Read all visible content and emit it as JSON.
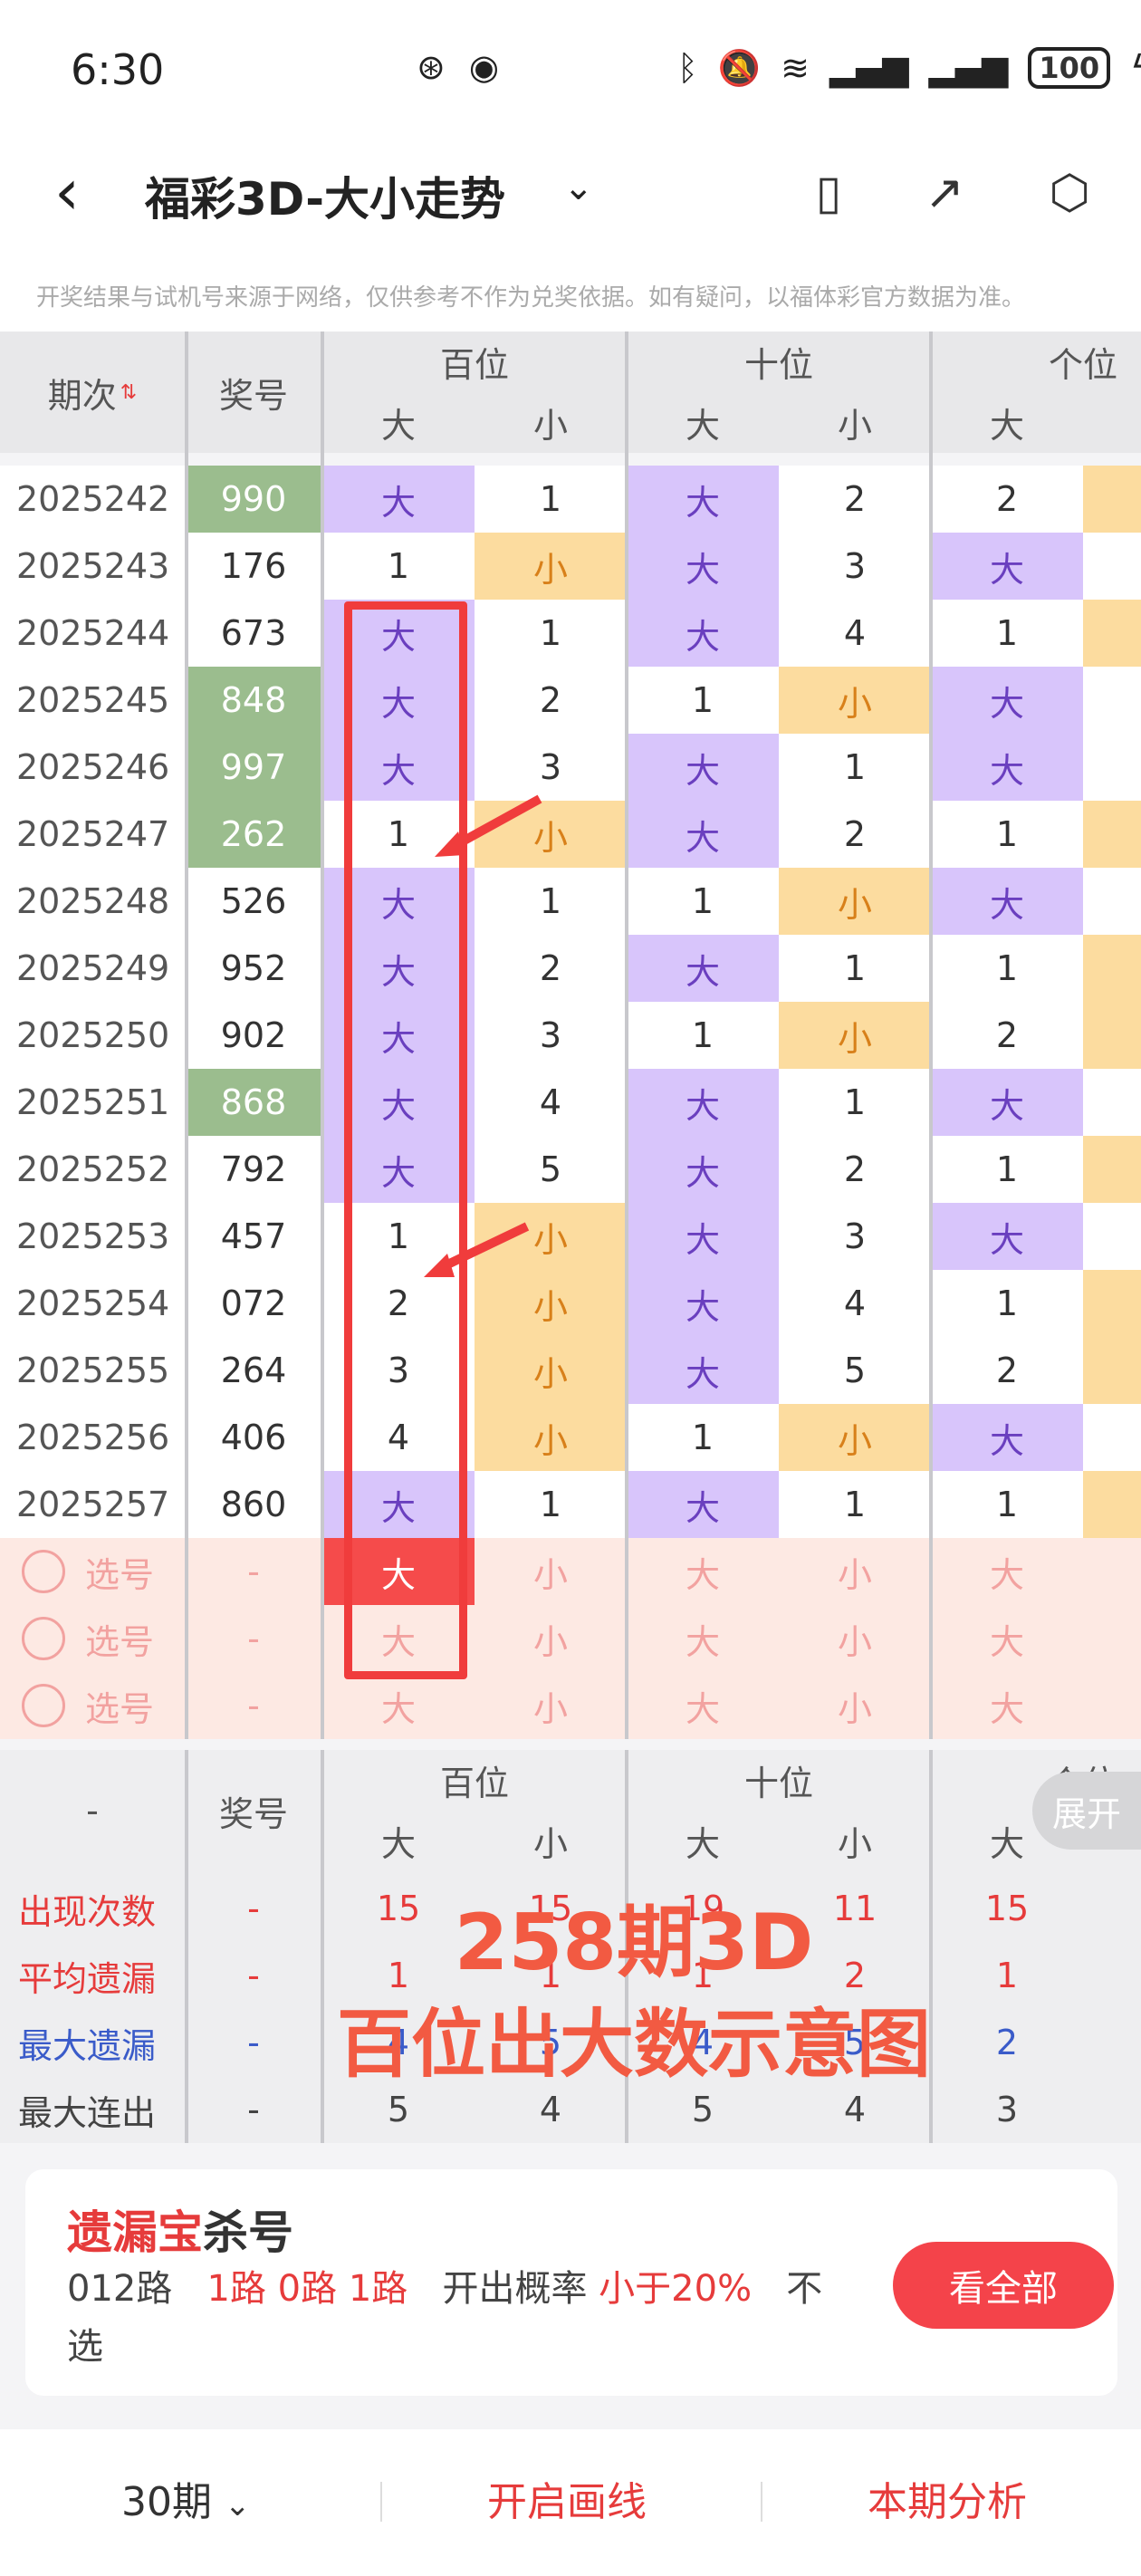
{
  "status": {
    "time": "6:30",
    "battery": "100"
  },
  "header": {
    "title": "福彩3D-大小走势"
  },
  "notice": "开奖结果与试机号来源于网络，仅供参考不作为兑奖依据。如有疑问，以福体彩官方数据为准。",
  "table": {
    "col_period": "期次",
    "col_number": "奖号",
    "groups": [
      "百位",
      "十位",
      "个位"
    ],
    "sub": {
      "big": "大",
      "small": "小"
    },
    "rows": [
      {
        "period": "2025242",
        "number": "990",
        "green": true,
        "bai": [
          "大",
          "1"
        ],
        "shi": [
          "大",
          "2"
        ],
        "ge": [
          "2"
        ]
      },
      {
        "period": "2025243",
        "number": "176",
        "green": false,
        "bai": [
          "1",
          "小"
        ],
        "shi": [
          "大",
          "3"
        ],
        "ge": [
          "大"
        ]
      },
      {
        "period": "2025244",
        "number": "673",
        "green": false,
        "bai": [
          "大",
          "1"
        ],
        "shi": [
          "大",
          "4"
        ],
        "ge": [
          "1"
        ]
      },
      {
        "period": "2025245",
        "number": "848",
        "green": true,
        "bai": [
          "大",
          "2"
        ],
        "shi": [
          "1",
          "小"
        ],
        "ge": [
          "大"
        ]
      },
      {
        "period": "2025246",
        "number": "997",
        "green": true,
        "bai": [
          "大",
          "3"
        ],
        "shi": [
          "大",
          "1"
        ],
        "ge": [
          "大"
        ]
      },
      {
        "period": "2025247",
        "number": "262",
        "green": true,
        "bai": [
          "1",
          "小"
        ],
        "shi": [
          "大",
          "2"
        ],
        "ge": [
          "1"
        ]
      },
      {
        "period": "2025248",
        "number": "526",
        "green": false,
        "bai": [
          "大",
          "1"
        ],
        "shi": [
          "1",
          "小"
        ],
        "ge": [
          "大"
        ]
      },
      {
        "period": "2025249",
        "number": "952",
        "green": false,
        "bai": [
          "大",
          "2"
        ],
        "shi": [
          "大",
          "1"
        ],
        "ge": [
          "1"
        ]
      },
      {
        "period": "2025250",
        "number": "902",
        "green": false,
        "bai": [
          "大",
          "3"
        ],
        "shi": [
          "1",
          "小"
        ],
        "ge": [
          "2"
        ]
      },
      {
        "period": "2025251",
        "number": "868",
        "green": true,
        "bai": [
          "大",
          "4"
        ],
        "shi": [
          "大",
          "1"
        ],
        "ge": [
          "大"
        ]
      },
      {
        "period": "2025252",
        "number": "792",
        "green": false,
        "bai": [
          "大",
          "5"
        ],
        "shi": [
          "大",
          "2"
        ],
        "ge": [
          "1"
        ]
      },
      {
        "period": "2025253",
        "number": "457",
        "green": false,
        "bai": [
          "1",
          "小"
        ],
        "shi": [
          "大",
          "3"
        ],
        "ge": [
          "大"
        ]
      },
      {
        "period": "2025254",
        "number": "072",
        "green": false,
        "bai": [
          "2",
          "小"
        ],
        "shi": [
          "大",
          "4"
        ],
        "ge": [
          "1"
        ]
      },
      {
        "period": "2025255",
        "number": "264",
        "green": false,
        "bai": [
          "3",
          "小"
        ],
        "shi": [
          "大",
          "5"
        ],
        "ge": [
          "2"
        ]
      },
      {
        "period": "2025256",
        "number": "406",
        "green": false,
        "bai": [
          "4",
          "小"
        ],
        "shi": [
          "1",
          "小"
        ],
        "ge": [
          "大"
        ]
      },
      {
        "period": "2025257",
        "number": "860",
        "green": false,
        "bai": [
          "大",
          "1"
        ],
        "shi": [
          "大",
          "1"
        ],
        "ge": [
          "1"
        ]
      }
    ],
    "pick_rows": [
      {
        "label": "选号",
        "dash": "-",
        "cells": [
          "大",
          "小",
          "大",
          "小",
          "大"
        ]
      },
      {
        "label": "选号",
        "dash": "-",
        "cells": [
          "大",
          "小",
          "大",
          "小",
          "大"
        ]
      },
      {
        "label": "选号",
        "dash": "-",
        "cells": [
          "大",
          "小",
          "大",
          "小",
          "大"
        ]
      }
    ]
  },
  "stats": {
    "header_dash": "-",
    "header_number": "奖号",
    "expand": "展开",
    "rows": [
      {
        "label": "出现次数",
        "dash": "-",
        "values": [
          "15",
          "15",
          "19",
          "11",
          "15"
        ],
        "color": "red"
      },
      {
        "label": "平均遗漏",
        "dash": "-",
        "values": [
          "1",
          "1",
          "1",
          "2",
          "1"
        ],
        "color": "red"
      },
      {
        "label": "最大遗漏",
        "dash": "-",
        "values": [
          "4",
          "5",
          "4",
          "5",
          "2"
        ],
        "color": "blue"
      },
      {
        "label": "最大连出",
        "dash": "-",
        "values": [
          "5",
          "4",
          "5",
          "4",
          "3"
        ],
        "color": "dark"
      }
    ]
  },
  "annotation": {
    "line1": "258期3D",
    "line2": "百位出大数示意图"
  },
  "panel": {
    "title_red": "遗漏宝",
    "title_dark": "杀号",
    "prefix": "012路",
    "routes": "1路 0路 1路",
    "mid": "开出概率",
    "rate": "小于20%",
    "suffix": "不选",
    "button": "看全部"
  },
  "bottom": {
    "periods": "30期",
    "draw": "开启画线",
    "analysis": "本期分析"
  },
  "colors": {
    "purple": "#d8c5fb",
    "orange": "#fcdc9f",
    "green": "#9bbd8e",
    "accent": "#f4434a"
  }
}
